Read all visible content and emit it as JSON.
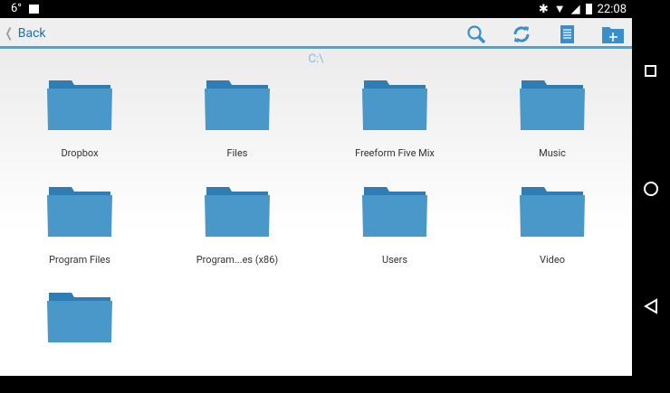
{
  "status": {
    "temperature": "6°",
    "time": "22:08"
  },
  "toolbar": {
    "back_label": "Back"
  },
  "path": "C:\\",
  "folders": [
    "Dropbox",
    "Files",
    "Freeform Five Mix",
    "Music",
    "Program Files",
    "Program...es (x86)",
    "Users",
    "Video",
    ""
  ],
  "colors": {
    "accent": "#3ba9dc",
    "folder": "#4a97c9",
    "folder_tab": "#2f7db5"
  }
}
